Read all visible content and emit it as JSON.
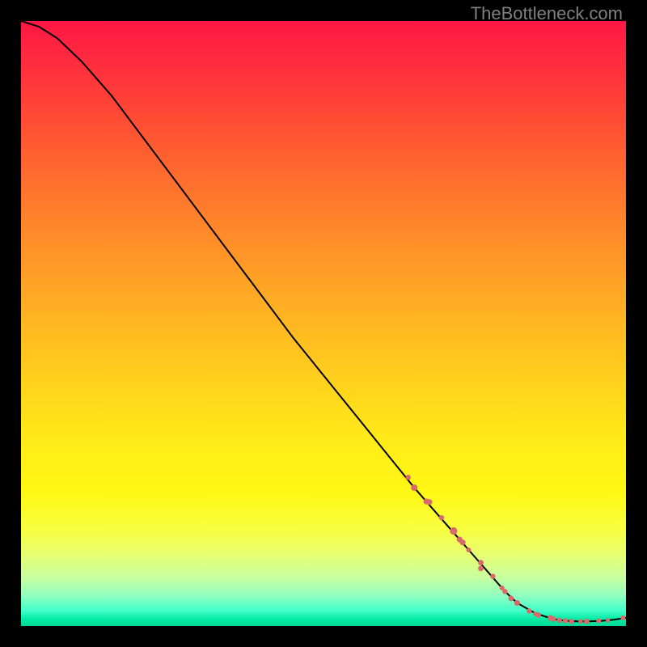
{
  "attribution": "TheBottleneck.com",
  "chart_data": {
    "type": "line",
    "title": "",
    "xlabel": "",
    "ylabel": "",
    "xlim": [
      0,
      100
    ],
    "ylim": [
      0,
      105
    ],
    "series": [
      {
        "name": "curve",
        "x": [
          0,
          3,
          6,
          10,
          15,
          20,
          25,
          30,
          35,
          40,
          45,
          50,
          55,
          60,
          65,
          70,
          75,
          80,
          82,
          85,
          88,
          90,
          92,
          94,
          96,
          98,
          100
        ],
        "y": [
          105,
          104,
          102,
          98,
          92,
          85,
          78,
          71,
          64,
          57,
          50,
          43.5,
          37,
          30.5,
          24,
          18,
          12,
          6,
          4,
          2.2,
          1.2,
          0.9,
          0.8,
          0.8,
          0.9,
          1.1,
          1.4
        ]
      }
    ],
    "markers": {
      "name": "data-points",
      "color": "#d96a6a",
      "points": [
        {
          "x": 64.0,
          "y": 25.8,
          "r": 3.2
        },
        {
          "x": 65.0,
          "y": 24.0,
          "r": 4.0
        },
        {
          "x": 67.0,
          "y": 21.6,
          "r": 3.6
        },
        {
          "x": 67.5,
          "y": 21.5,
          "r": 3.6
        },
        {
          "x": 69.5,
          "y": 18.8,
          "r": 3.2
        },
        {
          "x": 71.5,
          "y": 16.5,
          "r": 4.6
        },
        {
          "x": 72.5,
          "y": 15.0,
          "r": 3.6
        },
        {
          "x": 73.0,
          "y": 14.5,
          "r": 3.6
        },
        {
          "x": 74.0,
          "y": 13.2,
          "r": 3.0
        },
        {
          "x": 76.0,
          "y": 11.0,
          "r": 3.4
        },
        {
          "x": 76.0,
          "y": 10.0,
          "r": 3.4
        },
        {
          "x": 78.0,
          "y": 8.6,
          "r": 3.2
        },
        {
          "x": 79.5,
          "y": 6.6,
          "r": 3.0
        },
        {
          "x": 80.0,
          "y": 6.0,
          "r": 3.2
        },
        {
          "x": 81.0,
          "y": 4.8,
          "r": 3.4
        },
        {
          "x": 82.0,
          "y": 4.0,
          "r": 3.6
        },
        {
          "x": 84.0,
          "y": 2.6,
          "r": 3.2
        },
        {
          "x": 85.0,
          "y": 2.1,
          "r": 2.8
        },
        {
          "x": 85.5,
          "y": 1.9,
          "r": 3.4
        },
        {
          "x": 87.5,
          "y": 1.4,
          "r": 3.4
        },
        {
          "x": 88.0,
          "y": 1.2,
          "r": 3.4
        },
        {
          "x": 89.0,
          "y": 1.0,
          "r": 3.2
        },
        {
          "x": 90.0,
          "y": 0.9,
          "r": 3.2
        },
        {
          "x": 91.0,
          "y": 0.8,
          "r": 3.2
        },
        {
          "x": 92.5,
          "y": 0.8,
          "r": 2.8
        },
        {
          "x": 93.5,
          "y": 0.8,
          "r": 3.4
        },
        {
          "x": 95.5,
          "y": 0.9,
          "r": 3.0
        },
        {
          "x": 97.0,
          "y": 1.0,
          "r": 2.6
        },
        {
          "x": 99.5,
          "y": 1.4,
          "r": 3.0
        }
      ]
    }
  }
}
